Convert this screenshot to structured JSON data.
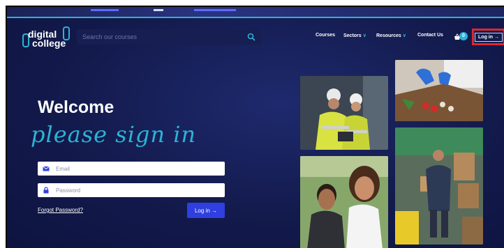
{
  "header": {
    "logo_line1": "digital",
    "logo_line2": "college",
    "search_placeholder": "Search our courses",
    "nav": {
      "courses": "Courses",
      "sectors": "Sectors",
      "resources": "Resources",
      "contact": "Contact Us"
    },
    "basket_count": "0",
    "login_label": "Log in →"
  },
  "form": {
    "welcome": "Welcome",
    "subtitle": "please sign in",
    "email_placeholder": "Email",
    "password_placeholder": "Password",
    "forgot_label": "Forgot Password?",
    "login_button": "Log in →"
  },
  "colors": {
    "background": "#131a4c",
    "accent": "#2bb3d6",
    "button": "#2f3fe0",
    "highlight_box": "#e0262e"
  },
  "icons": [
    "search-icon",
    "basket-icon",
    "envelope-icon",
    "lock-icon",
    "chevron-down-icon"
  ]
}
